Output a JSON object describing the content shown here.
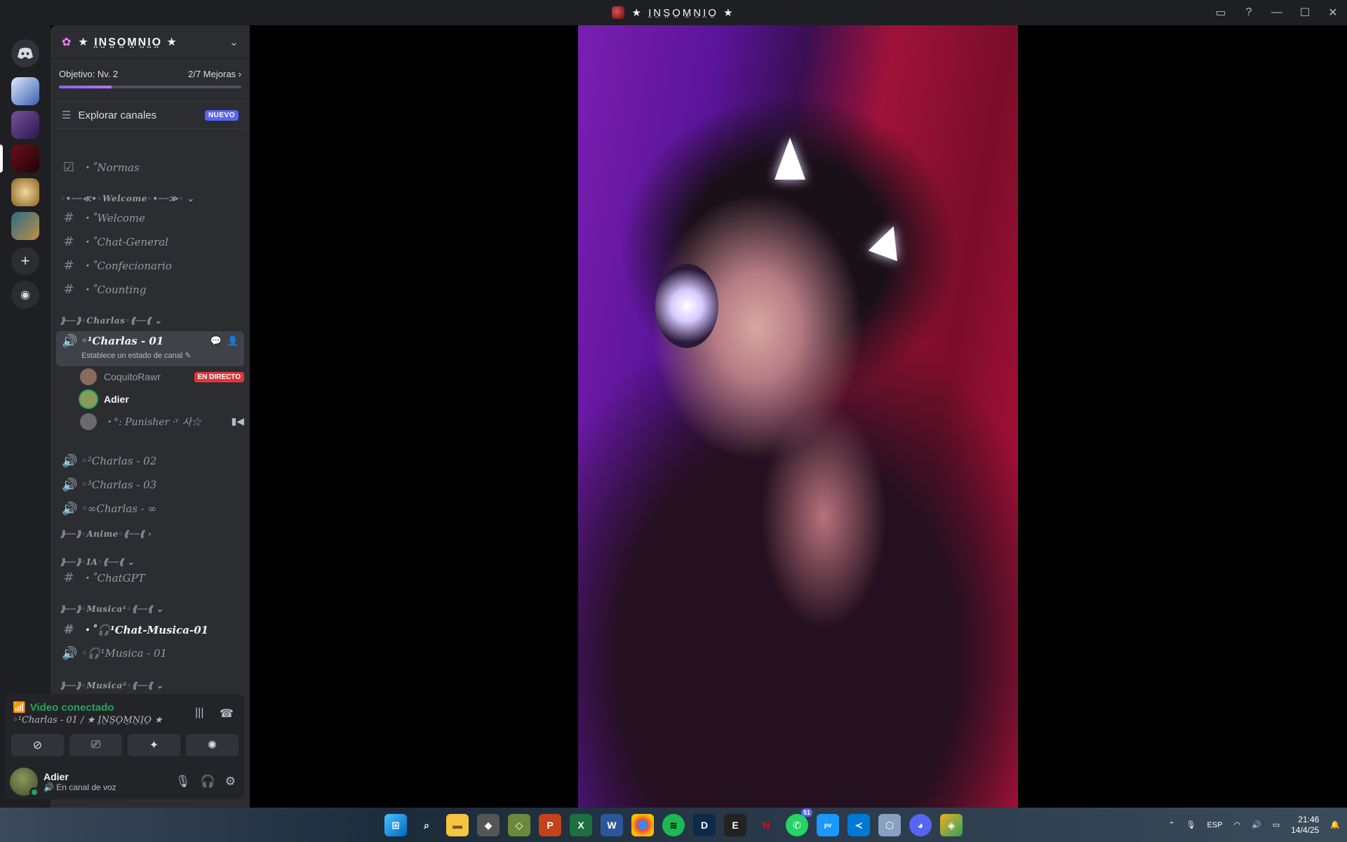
{
  "window": {
    "title": "★ I̤N̤S̤O̤M̤N̤I̤O̤ ★"
  },
  "server": {
    "name": "★ I̤N̤S̤O̤M̤N̤I̤O̤ ★",
    "boost": {
      "goal": "Objetivo: Nv. 2",
      "progress_text": "2/7 Mejoras",
      "progress": 0.29
    },
    "explore": {
      "label": "Explorar canales",
      "badge": "NUEVO"
    }
  },
  "channels": {
    "normas": "・˚Normas",
    "cat_welcome": "◦•──≪•◦Welcome◦•──≫◦",
    "welcome": "・˚Welcome",
    "chat_general": "・˚Chat-General",
    "confecionario": "・˚Confecionario",
    "counting": "・˚Counting",
    "cat_charlas": "⟫──⟫◦Charlas◦⟪──⟪",
    "charlas01": "◦¹Charlas - 01",
    "charlas01_status": "Establece un estado de canal",
    "charlas02": "◦²Charlas - 02",
    "charlas03": "◦³Charlas - 03",
    "charlas_inf": "◦∞Charlas - ∞",
    "cat_anime": "⟫──⟫◦Anime◦⟪──⟪",
    "cat_ia": "⟫──⟫◦IA◦⟪──⟪",
    "chatgpt": "・˚ChatGPT",
    "cat_musica1": "⟫──⟫◦Musica¹◦⟪──⟪",
    "chat_musica": "・˚🎧¹Chat-Musica-01",
    "musica01": "◦🎧¹Musica - 01",
    "cat_musica2": "⟫──⟫◦Musica²◦⟪──⟪"
  },
  "voice_users": [
    {
      "name": "CoquitoRawr",
      "badge": "EN DIRECTO"
    },
    {
      "name": "Adier"
    },
    {
      "name": "・°: Punisher ·ᵛ 사☆"
    }
  ],
  "voice_panel": {
    "status": "Video conectado",
    "location": "◦¹Charlas - 01 / ★ I̤N̤S̤O̤M̤N̤I̤O̤ ★"
  },
  "user": {
    "name": "Adier",
    "status": "En canal de voz"
  },
  "tray": {
    "lang": "ESP",
    "time": "21:46",
    "date": "14/4/25",
    "whatsapp_badge": "51"
  },
  "colors": {
    "accent": "#5865f2",
    "live": "#da373c",
    "connected": "#23a55a"
  }
}
